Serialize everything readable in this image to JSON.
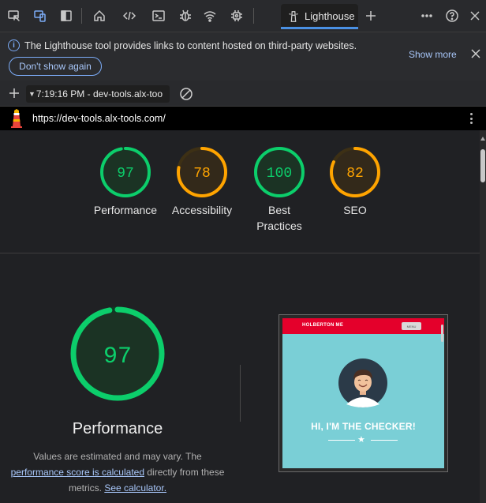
{
  "devtools": {
    "active_tab": "Lighthouse",
    "tab_icons": [
      "inspect-icon",
      "device-emulation-icon",
      "drawer-icon",
      "welcome-home-icon",
      "elements-code-icon",
      "console-icon",
      "sources-bug-icon",
      "network-wifi-icon",
      "performance-cpu-icon",
      "lighthouse-icon",
      "more-tools-plus-icon",
      "more-options-icon",
      "help-icon",
      "close-devtools-icon"
    ]
  },
  "infobar": {
    "message": "The Lighthouse tool provides links to content hosted on third-party websites.",
    "dont_show_label": "Don't show again",
    "show_more_label": "Show more"
  },
  "toolbar": {
    "report_label": "7:19:16 PM - dev-tools.alx-too"
  },
  "url": "https://dev-tools.alx-tools.com/",
  "colors": {
    "good": "#0cce6b",
    "average": "#ffa400"
  },
  "scores": [
    {
      "label": "Performance",
      "value": 97,
      "rating": "good"
    },
    {
      "label": "Accessibility",
      "value": 78,
      "rating": "average"
    },
    {
      "label": "Best Practices",
      "value": 100,
      "rating": "good"
    },
    {
      "label": "SEO",
      "value": 82,
      "rating": "average"
    }
  ],
  "performance": {
    "score": 97,
    "title": "Performance",
    "desc_prefix": "Values are estimated and may vary. The",
    "link1": "performance score is calculated",
    "desc_mid": "directly from these metrics.",
    "link2": "See calculator."
  },
  "screenshot": {
    "brand": "HOLBERTON ME",
    "button_text": "MENU",
    "headline": "HI, I'M THE CHECKER!"
  }
}
